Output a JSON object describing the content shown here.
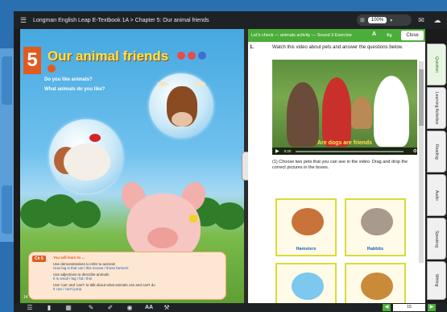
{
  "window": {
    "title": "Longman English Leap E-Textbook 1A > Chapter 5: Our animal friends",
    "zoom": "100%"
  },
  "left_page": {
    "chapter_number": "5",
    "chapter_title": "Our animal friends",
    "question1": "Do you like animals?",
    "question2": "What animals do you like?",
    "page_number": "14",
    "info_box": {
      "badge": "Ch 5",
      "heading": "You will learn to ...",
      "item1": "Use demonstratives to refer to animals",
      "item1_example": "How big is that cat / this mouse / those farmers",
      "item2": "Use adjectives to describe animals",
      "item2_example": "It is small / big / fat / thin",
      "item3": "Use 'can' and 'can't' to talk about what animals can and can't do",
      "item3_example": "It can / can't jump"
    }
  },
  "right_panel": {
    "header_label": "Let's check — animals activity — Sound 3 Exercise",
    "font_button": "A",
    "close_button": "Close",
    "question_number": "1.",
    "question_text": "Watch this video about pets and answer the questions below.",
    "video_caption": "Are dogs are friends",
    "video_time": "0:20",
    "sub_question": "(1) Choose two pets that you can see in the video. Drag and drop the correct pictures in the boxes.",
    "cards": [
      {
        "label": "Hamsters"
      },
      {
        "label": "Rabbits"
      },
      {
        "label": ""
      },
      {
        "label": ""
      }
    ]
  },
  "side_tabs": [
    "Question",
    "Learning Activities",
    "Reading",
    "Audio",
    "Speaking",
    "Writing"
  ],
  "toolbar": {
    "font_size_label": "AA",
    "page_input": "15"
  }
}
